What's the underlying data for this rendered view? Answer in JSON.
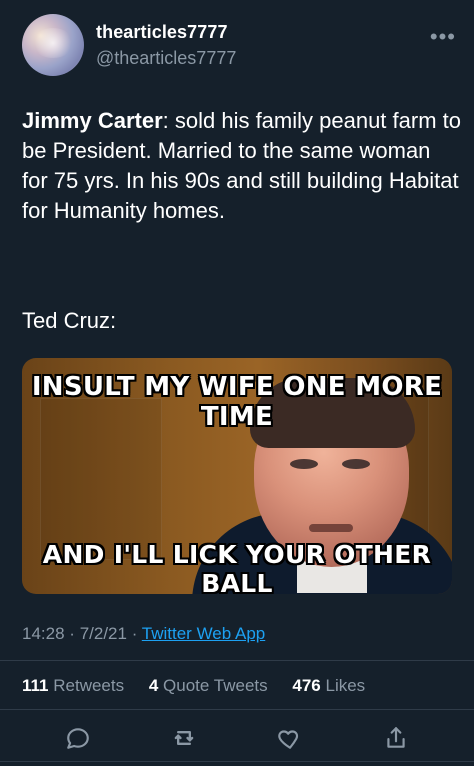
{
  "user": {
    "display_name": "thearticles7777",
    "handle": "@thearticles7777"
  },
  "tweet": {
    "bold_name": "Jimmy Carter",
    "text_after_bold": ": sold his family peanut farm to be President. Married to the same woman for 75 yrs. In his 90s and still building Habitat for Humanity homes.",
    "second_line": "Ted Cruz:"
  },
  "media": {
    "meme_top": "INSULT MY WIFE ONE MORE TIME",
    "meme_bottom": "AND I'LL LICK YOUR OTHER BALL"
  },
  "meta": {
    "time": "14:28",
    "date": "7/2/21",
    "separator": "·",
    "source": "Twitter Web App"
  },
  "stats": {
    "retweets_count": "111",
    "retweets_label": "Retweets",
    "quotes_count": "4",
    "quotes_label": "Quote Tweets",
    "likes_count": "476",
    "likes_label": "Likes"
  },
  "icons": {
    "more": "more-icon",
    "reply": "reply-icon",
    "retweet": "retweet-icon",
    "like": "like-icon",
    "share": "share-icon"
  },
  "colors": {
    "background": "#15202b",
    "secondary_text": "#8b98a5",
    "link": "#1da1f2"
  }
}
